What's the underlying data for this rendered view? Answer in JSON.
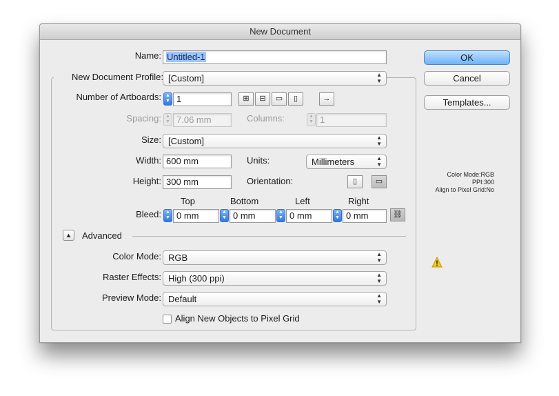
{
  "window": {
    "title": "New Document"
  },
  "form": {
    "name_label": "Name:",
    "name_value": "Untitled-1",
    "profile_label": "New Document Profile:",
    "profile_value": "[Custom]",
    "artboards_label": "Number of Artboards:",
    "artboards_value": "1",
    "spacing_label": "Spacing:",
    "spacing_value": "7.06 mm",
    "columns_label": "Columns:",
    "columns_value": "1",
    "size_label": "Size:",
    "size_value": "[Custom]",
    "width_label": "Width:",
    "width_value": "600 mm",
    "units_label": "Units:",
    "units_value": "Millimeters",
    "height_label": "Height:",
    "height_value": "300 mm",
    "orientation_label": "Orientation:",
    "bleed_label": "Bleed:",
    "bleed_top_label": "Top",
    "bleed_bottom_label": "Bottom",
    "bleed_left_label": "Left",
    "bleed_right_label": "Right",
    "bleed_top": "0 mm",
    "bleed_bottom": "0 mm",
    "bleed_left": "0 mm",
    "bleed_right": "0 mm",
    "advanced_label": "Advanced",
    "color_mode_label": "Color Mode:",
    "color_mode_value": "RGB",
    "raster_label": "Raster Effects:",
    "raster_value": "High (300 ppi)",
    "preview_label": "Preview Mode:",
    "preview_value": "Default",
    "align_pixel_label": "Align New Objects to Pixel Grid",
    "align_pixel_checked": false
  },
  "buttons": {
    "ok": "OK",
    "cancel": "Cancel",
    "templates": "Templates..."
  },
  "summary": {
    "color_mode": "Color Mode:RGB",
    "ppi": "PPI:300",
    "align": "Align to Pixel Grid:No"
  },
  "icons": [
    "grid-by-row-icon",
    "grid-by-column-icon",
    "arrange-by-row-icon",
    "arrange-by-column-icon",
    "layout-direction-icon",
    "portrait-icon",
    "landscape-icon",
    "link-bleed-icon",
    "advanced-toggle-icon",
    "warning-icon"
  ],
  "colors": {
    "default_button": "#6fb3f7",
    "selection": "#9fc5f8",
    "warning": "#f2c81a"
  }
}
